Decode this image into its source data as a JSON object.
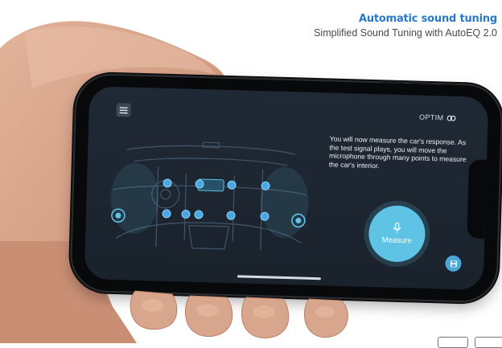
{
  "headline": {
    "title": "Automatic sound tuning",
    "subtitle": "Simplified Sound Tuning with AutoEQ 2.0"
  },
  "app": {
    "brand": "OPTIM",
    "brand_icon": "link-icon",
    "menu_icon": "hamburger-menu-icon",
    "instructions": "You will now measure the car's response. As the test signal plays, you will move the microphone through many points to measure the car's interior.",
    "measure_button": {
      "label": "Measure",
      "icon": "microphone-icon"
    },
    "save_icon": "save-icon"
  },
  "colors": {
    "headline_accent": "#2a79c8",
    "screen_background": "#1f2935",
    "accent_cyan": "#5fc3e6",
    "measurement_point": "#4aa7e6"
  },
  "car_diagram": {
    "measurement_points": 9,
    "speaker_icon": "speaker-icon"
  }
}
